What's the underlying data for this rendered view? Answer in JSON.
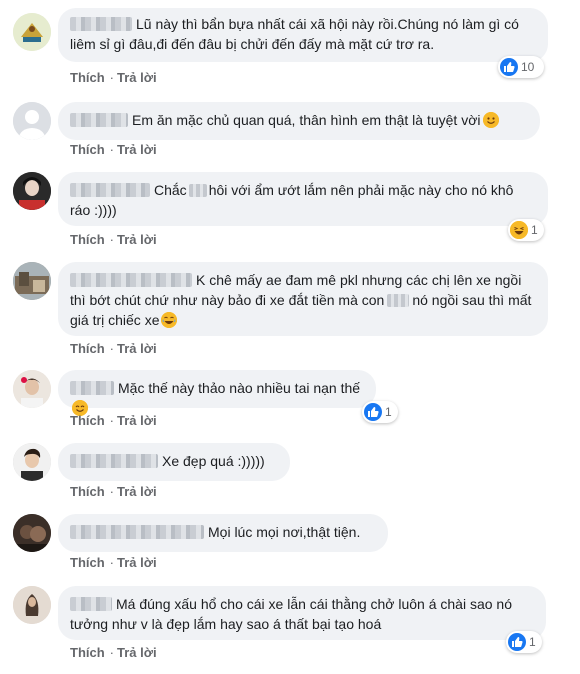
{
  "actions": {
    "like": "Thích",
    "reply": "Trả lời"
  },
  "comments": [
    {
      "text_before": "",
      "text": "Lũ này thì bẩn bựa nhất cái xã hội này rồi.Chúng nó làm gì có liêm sỉ gì đâu,đi đến đâu bị chửi đến đấy mà mặt cứ trơ ra.",
      "reaction_icon": "like-icon",
      "reaction_count": "10"
    },
    {
      "text": "Em ăn mặc chủ quan quá, thân hình em thật là tuyệt vời",
      "emoji": "smile-emoji"
    },
    {
      "text_a": "Chắc",
      "text_b": "hôi với ẩm ướt lắm nên phải mặc này cho nó khô ráo :))))",
      "reaction_icon": "haha-icon",
      "reaction_count": "1"
    },
    {
      "text_a": "K chê mấy ae đam mê pkl nhưng các chị lên xe ngồi thì bớt chút chứ như này bảo đi xe đắt tiền mà con",
      "text_b": "nó ngồi sau thì mất giá trị chiếc xe",
      "emoji": "laugh-emoji"
    },
    {
      "text": "Mặc thế này thảo nào nhiều tai nạn thế",
      "emoji": "smile-emoji",
      "reaction_icon": "like-icon",
      "reaction_count": "1"
    },
    {
      "text": "Xe đẹp quá :)))))"
    },
    {
      "text": "Mọi lúc mọi nơi,thật tiện."
    },
    {
      "text": "Má đúng xấu hổ cho cái xe lẫn cái thằng chở luôn á chài sao nó tưởng như v là đẹp lắm hay sao á thất bại tạo hoá",
      "reaction_icon": "like-icon",
      "reaction_count": "1"
    }
  ],
  "colors": {
    "bubble": "#f0f2f5",
    "action_text": "#65676b",
    "like_blue": "#1877f2",
    "haha_yellow": "#f7b928"
  }
}
